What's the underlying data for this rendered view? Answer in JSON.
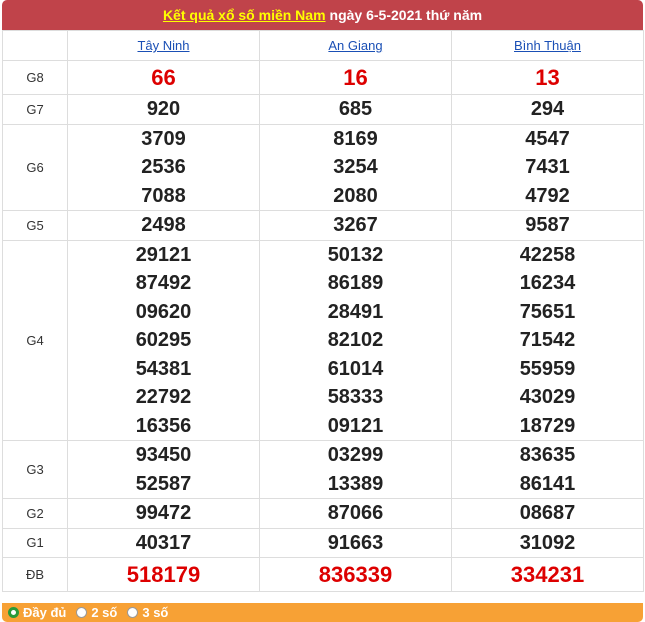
{
  "header": {
    "link_text": "Kết quả xổ số miền Nam",
    "date_text": "ngày 6-5-2021 thứ năm"
  },
  "provinces": [
    "Tây Ninh",
    "An Giang",
    "Bình Thuận"
  ],
  "prizes": [
    {
      "label": "G8",
      "highlight": true,
      "values": [
        [
          "66"
        ],
        [
          "16"
        ],
        [
          "13"
        ]
      ]
    },
    {
      "label": "G7",
      "highlight": false,
      "values": [
        [
          "920"
        ],
        [
          "685"
        ],
        [
          "294"
        ]
      ]
    },
    {
      "label": "G6",
      "highlight": false,
      "values": [
        [
          "3709",
          "2536",
          "7088"
        ],
        [
          "8169",
          "3254",
          "2080"
        ],
        [
          "4547",
          "7431",
          "4792"
        ]
      ]
    },
    {
      "label": "G5",
      "highlight": false,
      "values": [
        [
          "2498"
        ],
        [
          "3267"
        ],
        [
          "9587"
        ]
      ]
    },
    {
      "label": "G4",
      "highlight": false,
      "values": [
        [
          "29121",
          "87492",
          "09620",
          "60295",
          "54381",
          "22792",
          "16356"
        ],
        [
          "50132",
          "86189",
          "28491",
          "82102",
          "61014",
          "58333",
          "09121"
        ],
        [
          "42258",
          "16234",
          "75651",
          "71542",
          "55959",
          "43029",
          "18729"
        ]
      ]
    },
    {
      "label": "G3",
      "highlight": false,
      "values": [
        [
          "93450",
          "52587"
        ],
        [
          "03299",
          "13389"
        ],
        [
          "83635",
          "86141"
        ]
      ]
    },
    {
      "label": "G2",
      "highlight": false,
      "values": [
        [
          "99472"
        ],
        [
          "87066"
        ],
        [
          "08687"
        ]
      ]
    },
    {
      "label": "G1",
      "highlight": false,
      "values": [
        [
          "40317"
        ],
        [
          "91663"
        ],
        [
          "31092"
        ]
      ]
    },
    {
      "label": "ĐB",
      "highlight": true,
      "values": [
        [
          "518179"
        ],
        [
          "836339"
        ],
        [
          "334231"
        ]
      ]
    }
  ],
  "footer": {
    "options": [
      {
        "label": "Đầy đủ",
        "selected": true
      },
      {
        "label": "2 số",
        "selected": false
      },
      {
        "label": "3 số",
        "selected": false
      }
    ]
  },
  "colors": {
    "title_bg": "#c0434a",
    "title_link": "#ffff00",
    "highlight_number": "#dd0000",
    "footer_bg": "#f7a135",
    "province_link": "#1a4fb5"
  }
}
